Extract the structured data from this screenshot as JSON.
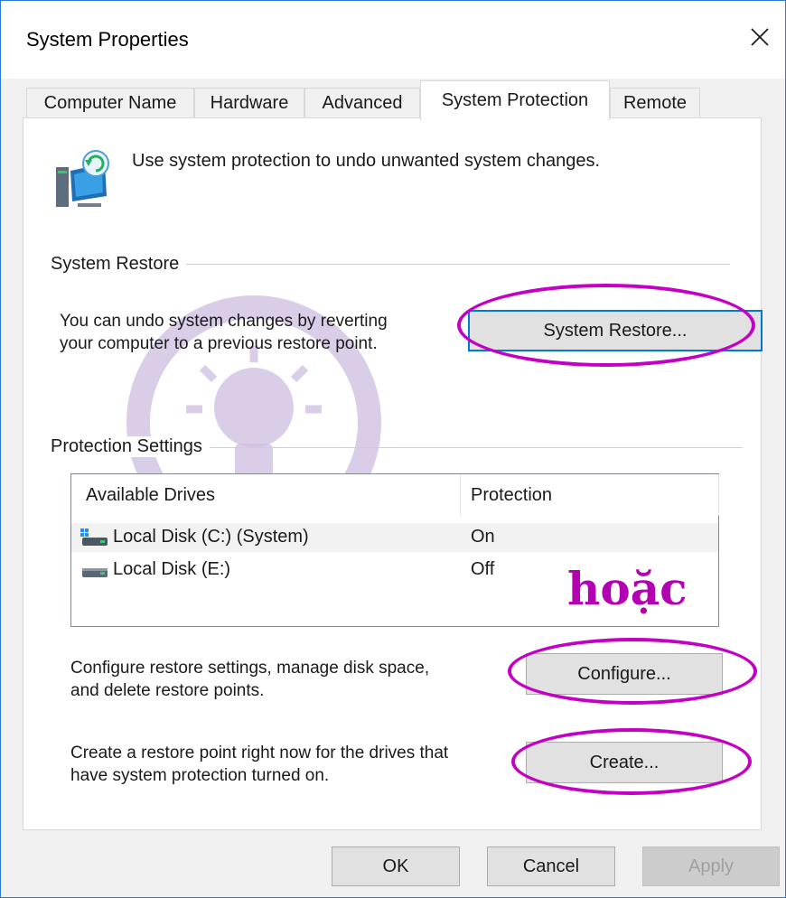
{
  "window": {
    "title": "System Properties"
  },
  "tabs": [
    {
      "label": "Computer Name",
      "active": false
    },
    {
      "label": "Hardware",
      "active": false
    },
    {
      "label": "Advanced",
      "active": false
    },
    {
      "label": "System Protection",
      "active": true
    },
    {
      "label": "Remote",
      "active": false
    }
  ],
  "intro_text": "Use system protection to undo unwanted system changes.",
  "system_restore": {
    "group_label": "System Restore",
    "description_line1": "You can undo system changes by reverting",
    "description_line2": "your computer to a previous restore point.",
    "button_label": "System Restore..."
  },
  "protection_settings": {
    "group_label": "Protection Settings",
    "columns": [
      "Available Drives",
      "Protection"
    ],
    "drives": [
      {
        "name": "Local Disk (C:) (System)",
        "protection": "On",
        "icon": "system-drive-icon"
      },
      {
        "name": "Local Disk (E:)",
        "protection": "Off",
        "icon": "drive-icon"
      }
    ]
  },
  "configure": {
    "description_line1": "Configure restore settings, manage disk space,",
    "description_line2": "and delete restore points.",
    "button_label": "Configure..."
  },
  "create": {
    "description_line1": "Create a restore point right now for the drives that",
    "description_line2": "have system protection turned on.",
    "button_label": "Create..."
  },
  "annotation_text": "hoặc",
  "footer": {
    "ok_label": "OK",
    "cancel_label": "Cancel",
    "apply_label": "Apply"
  },
  "colors": {
    "accent": "#0078d7",
    "annotation": "#c400c4",
    "watermark": "#c9b6dc"
  }
}
